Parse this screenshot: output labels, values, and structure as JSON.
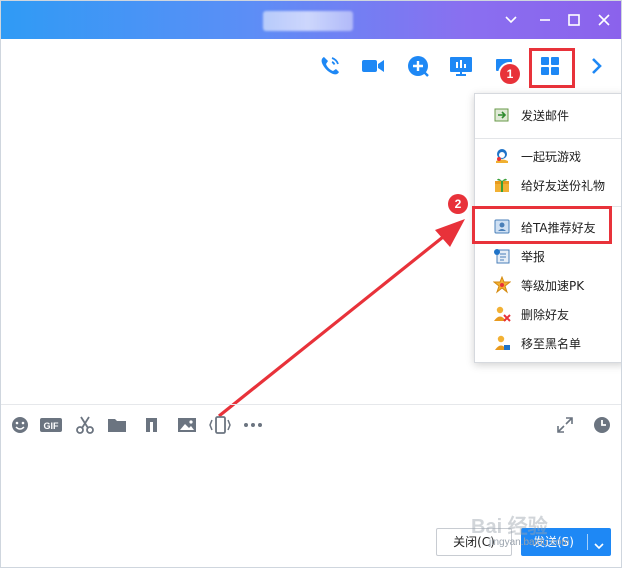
{
  "titlebar": {
    "title_obscured": true,
    "controls": [
      "chevron-down-icon",
      "minimize-icon",
      "maximize-icon",
      "close-icon"
    ]
  },
  "toolbar": {
    "icons": [
      "phone-icon",
      "video-icon",
      "add-chat-icon",
      "screen-share-icon",
      "remote-desktop-icon",
      "apps-grid-icon",
      "chevron-right-icon"
    ],
    "highlight_index": 5
  },
  "annotations": {
    "badge1": "1",
    "badge2": "2",
    "accent_color": "#e8323a"
  },
  "menu": {
    "groups": [
      [
        {
          "icon": "mail-send-icon",
          "label": "发送邮件"
        }
      ],
      [
        {
          "icon": "game-icon",
          "label": "一起玩游戏"
        },
        {
          "icon": "gift-icon",
          "label": "给好友送份礼物"
        }
      ],
      [
        {
          "icon": "recommend-contact-icon",
          "label": "给TA推荐好友"
        },
        {
          "icon": "report-icon",
          "label": "举报"
        },
        {
          "icon": "level-boost-icon",
          "label": "等级加速PK"
        },
        {
          "icon": "delete-friend-icon",
          "label": "删除好友"
        },
        {
          "icon": "blacklist-icon",
          "label": "移至黑名单"
        }
      ]
    ]
  },
  "input_toolbar": {
    "icons": [
      "emoji-icon",
      "gif-icon",
      "scissors-icon",
      "folder-icon",
      "music-icon",
      "image-icon",
      "shake-icon",
      "more-icon",
      "expand-icon",
      "history-clock-icon"
    ],
    "gif_text": "GIF"
  },
  "footer": {
    "close_label": "关闭(C)",
    "send_label": "发送(S)"
  },
  "watermark": {
    "text": "Bai 经验",
    "url": "jingyan.baidu.com"
  },
  "colors": {
    "title_gradient_start": "#2f9bf5",
    "title_gradient_end": "#8b62ec",
    "icon_blue": "#1e88f5",
    "send_button": "#1e88f5"
  }
}
